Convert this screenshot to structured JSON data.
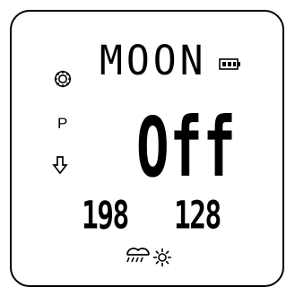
{
  "display": {
    "main_text": "MOON",
    "mode_label": "P",
    "status_text": "Off",
    "readout_left": "198",
    "readout_right": "128"
  },
  "icons": {
    "settings": "gear-icon",
    "battery": "battery-icon",
    "direction": "down-arrow-icon",
    "weather_rain": "rain-cloud-icon",
    "weather_sun": "sun-icon"
  },
  "colors": {
    "foreground": "#000000",
    "background": "#ffffff"
  }
}
